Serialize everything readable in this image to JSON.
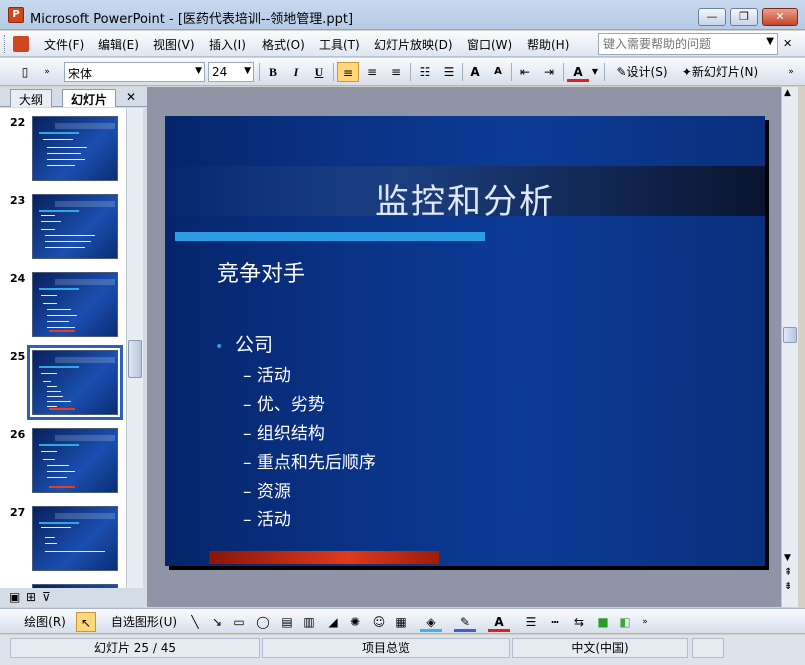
{
  "window": {
    "title": "Microsoft PowerPoint - [医药代表培训--领地管理.ppt]",
    "app_icon_label": "P",
    "controls": {
      "minimize": "—",
      "restore": "❐",
      "close": "✕"
    }
  },
  "menu": {
    "items": [
      "文件(F)",
      "编辑(E)",
      "视图(V)",
      "插入(I)",
      "格式(O)",
      "工具(T)",
      "幻灯片放映(D)",
      "窗口(W)",
      "帮助(H)"
    ],
    "help_placeholder": "键入需要帮助的问题",
    "doc_close": "✕"
  },
  "toolbar": {
    "font_name": "宋体",
    "font_size": "24",
    "bold": "B",
    "italic": "I",
    "underline": "U",
    "grow_font": "A",
    "shrink_font": "A",
    "font_color": "A",
    "design_label": "设计(S)",
    "new_slide_label": "新幻灯片(N)"
  },
  "left_pane": {
    "tabs": [
      "大纲",
      "幻灯片"
    ],
    "active_tab": "幻灯片",
    "close": "✕",
    "thumbnails": [
      {
        "number": "22"
      },
      {
        "number": "23"
      },
      {
        "number": "24"
      },
      {
        "number": "25",
        "selected": true
      },
      {
        "number": "26"
      },
      {
        "number": "27"
      }
    ]
  },
  "slide": {
    "title": "监控和分析",
    "subtitle": "竞争对手",
    "level1": "公司",
    "level2": [
      "活动",
      "优、劣势",
      "组织结构",
      "重点和先后顺序",
      "资源",
      "活动"
    ],
    "level2_marker": "–"
  },
  "draw_toolbar": {
    "draw_label": "绘图(R)",
    "autoshapes_label": "自选图形(U)"
  },
  "status": {
    "slide_position": "幻灯片 25 / 45",
    "design": "项目总览",
    "language": "中文(中国)"
  },
  "colors": {
    "slide_bg": "#0a3285",
    "accent_blue": "#2d9de8",
    "accent_red": "#e03a1a"
  }
}
